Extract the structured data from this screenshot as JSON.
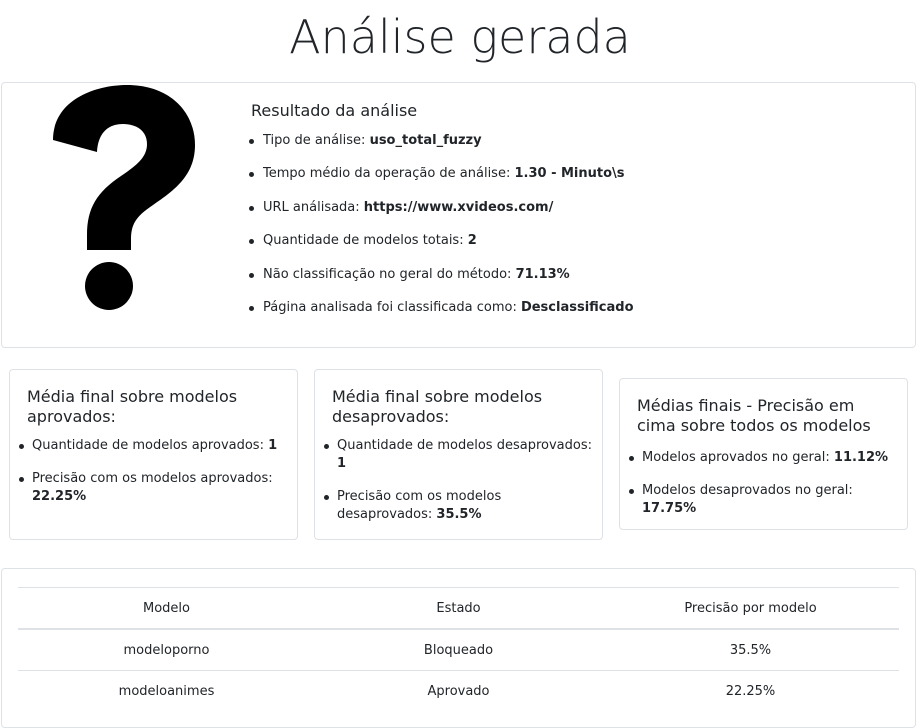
{
  "page_title": "Análise gerada",
  "result": {
    "icon": "question-mark-icon",
    "title": "Resultado da análise",
    "items": [
      {
        "label": "Tipo de análise: ",
        "value": "uso_total_fuzzy"
      },
      {
        "label": "Tempo médio da operação de análise: ",
        "value": "1.30 - Minuto\\s"
      },
      {
        "label": "URL análisada: ",
        "value": "https://www.xvideos.com/"
      },
      {
        "label": "Quantidade de modelos totais: ",
        "value": "2"
      },
      {
        "label": "Não classificação no geral do método: ",
        "value": "71.13%"
      },
      {
        "label": "Página analisada foi classificada como: ",
        "value": "Desclassificado"
      }
    ]
  },
  "approved": {
    "title": "Média final sobre modelos aprovados:",
    "items": [
      {
        "label": "Quantidade de modelos aprovados: ",
        "value": "1"
      },
      {
        "label": "Precisão com os modelos aprovados: ",
        "value": "22.25%"
      }
    ]
  },
  "disapproved": {
    "title": "Média final sobre modelos desaprovados:",
    "items": [
      {
        "label": "Quantidade de modelos desaprovados: ",
        "value": "1"
      },
      {
        "label": "Precisão com os modelos desaprovados: ",
        "value": "35.5%"
      }
    ]
  },
  "overall": {
    "title": "Médias finais - Precisão em cima sobre todos os modelos",
    "items": [
      {
        "label": "Modelos aprovados no geral: ",
        "value": "11.12%"
      },
      {
        "label": "Modelos desaprovados no geral: ",
        "value": "17.75%"
      }
    ]
  },
  "table": {
    "headers": [
      "Modelo",
      "Estado",
      "Precisão por modelo"
    ],
    "rows": [
      [
        "modeloporno",
        "Bloqueado",
        "35.5%"
      ],
      [
        "modeloanimes",
        "Aprovado",
        "22.25%"
      ]
    ]
  }
}
